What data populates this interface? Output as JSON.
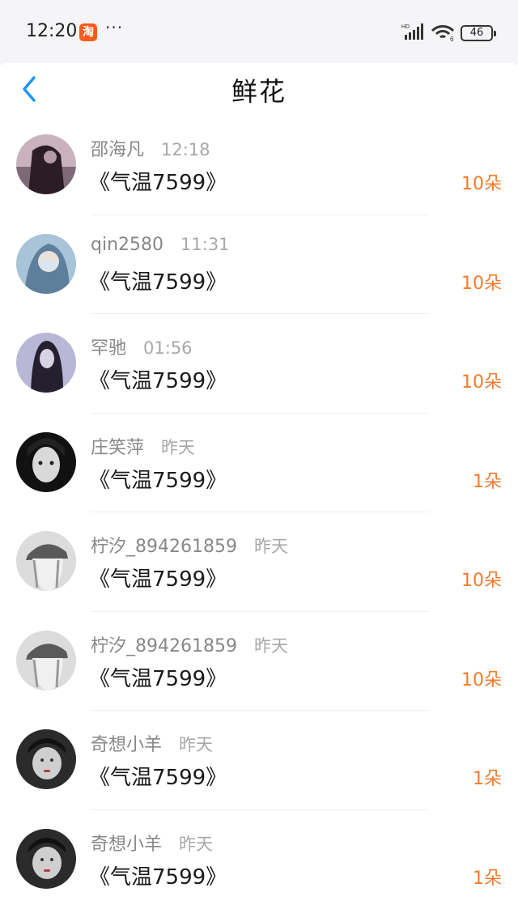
{
  "status_bar": {
    "time": "12:20",
    "app_badge": "淘",
    "more": "···",
    "network": "HD",
    "wifi_badge": "6",
    "battery": "46"
  },
  "header": {
    "title": "鲜花"
  },
  "items": [
    {
      "name": "邵海凡",
      "time": "12:18",
      "book": "《气温7599》",
      "count": "10朵"
    },
    {
      "name": "qin2580",
      "time": "11:31",
      "book": "《气温7599》",
      "count": "10朵"
    },
    {
      "name": "罕驰",
      "time": "01:56",
      "book": "《气温7599》",
      "count": "10朵"
    },
    {
      "name": "庄笑萍",
      "time": "昨天",
      "book": "《气温7599》",
      "count": "1朵"
    },
    {
      "name": "柠汐_894261859",
      "time": "昨天",
      "book": "《气温7599》",
      "count": "10朵"
    },
    {
      "name": "柠汐_894261859",
      "time": "昨天",
      "book": "《气温7599》",
      "count": "10朵"
    },
    {
      "name": "奇想小羊",
      "time": "昨天",
      "book": "《气温7599》",
      "count": "1朵"
    },
    {
      "name": "奇想小羊",
      "time": "昨天",
      "book": "《气温7599》",
      "count": "1朵"
    }
  ],
  "colors": {
    "accent": "#2196f3",
    "count": "#f47b2a"
  }
}
